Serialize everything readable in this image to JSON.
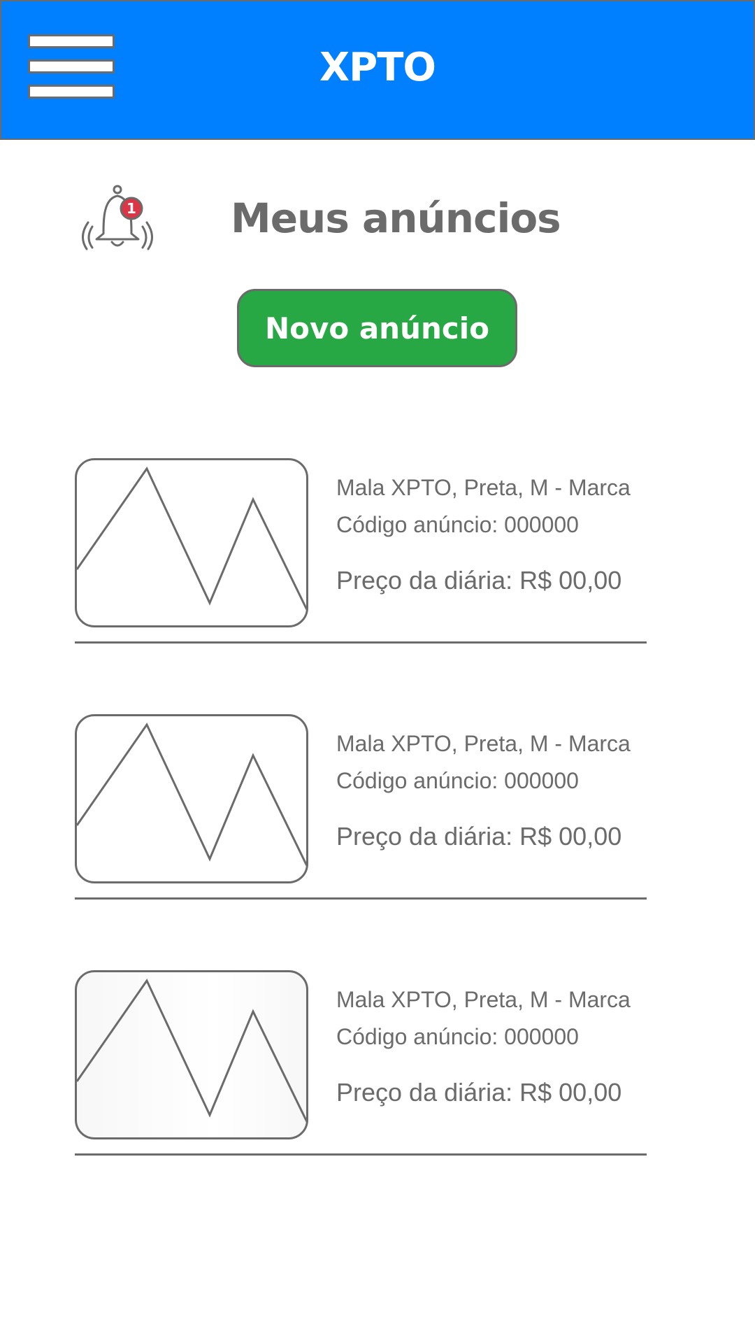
{
  "header": {
    "title": "XPTO",
    "menu_icon": "hamburger-menu-icon",
    "background_color": "#007fff"
  },
  "notifications": {
    "icon": "bell-icon",
    "count": "1"
  },
  "page": {
    "title": "Meus anúncios"
  },
  "actions": {
    "new_listing_label": "Novo anúncio",
    "new_listing_color": "#28a745"
  },
  "listings": [
    {
      "image": "image-placeholder-icon",
      "name": "Mala XPTO, Preta, M - Marca",
      "code": "Código anúncio: 000000",
      "price": "Preço da diária: R$ 00,00"
    },
    {
      "image": "image-placeholder-icon",
      "name": "Mala XPTO, Preta, M - Marca",
      "code": "Código anúncio: 000000",
      "price": "Preço da diária: R$ 00,00"
    },
    {
      "image": "image-placeholder-icon",
      "name": "Mala XPTO, Preta, M - Marca",
      "code": "Código anúncio: 000000",
      "price": "Preço da diária: R$ 00,00"
    }
  ]
}
